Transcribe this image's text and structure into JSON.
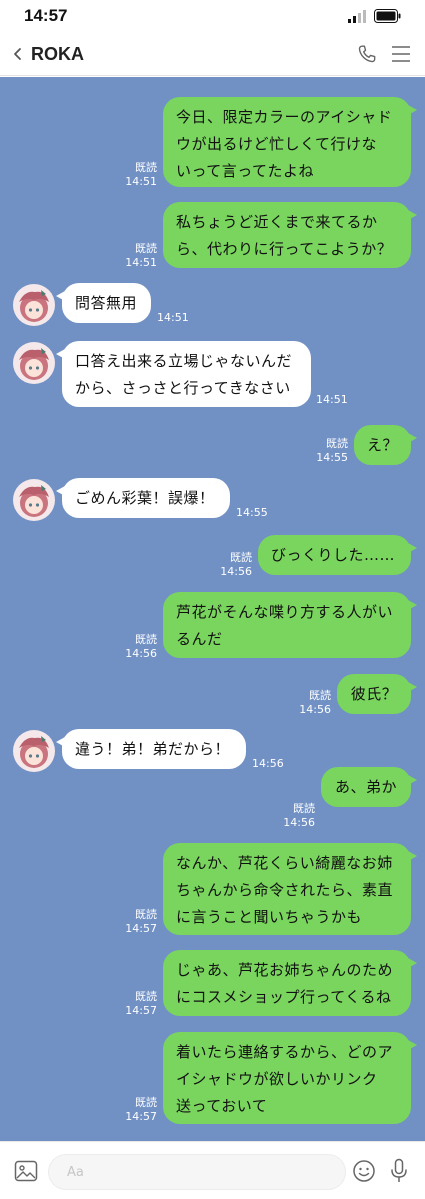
{
  "status_bar": {
    "time": "14:57"
  },
  "header": {
    "title": "ROKA"
  },
  "messages": [
    {
      "side": "out",
      "text": "今日、限定カラーのアイシャド\nウが出るけど忙しくて行けな\nいって言ってたよね",
      "read": "既読",
      "time": "14:51"
    },
    {
      "side": "out",
      "text": "私ちょうど近くまで来てるか\nら、代わりに行ってこようか？",
      "read": "既読",
      "time": "14:51"
    },
    {
      "side": "in",
      "text": "問答無用",
      "time": "14:51"
    },
    {
      "side": "in",
      "text": "口答え出来る立場じゃないんだ\nから、さっさと行ってきなさい",
      "time": "14:51"
    },
    {
      "side": "out",
      "text": "え？",
      "read": "既読",
      "time": "14:55"
    },
    {
      "side": "in",
      "text": "ごめん彩葉！誤爆！",
      "time": "14:55"
    },
    {
      "side": "out",
      "text": "びっくりした……",
      "read": "既読",
      "time": "14:56"
    },
    {
      "side": "out",
      "text": "芦花がそんな喋り方する人がい\nるんだ",
      "read": "既読",
      "time": "14:56"
    },
    {
      "side": "out",
      "text": "彼氏？",
      "read": "既読",
      "time": "14:56"
    },
    {
      "side": "in",
      "text": "違う！弟！弟だから！",
      "time": "14:56"
    },
    {
      "side": "out",
      "text": "あ、弟か",
      "read": "既読",
      "time": "14:56"
    },
    {
      "side": "out",
      "text": "なんか、芦花くらい綺麗なお姉\nちゃんから命令されたら、素直\nに言うこと聞いちゃうかも",
      "read": "既読",
      "time": "14:57"
    },
    {
      "side": "out",
      "text": "じゃあ、芦花お姉ちゃんのため\nにコスメショップ行ってくるね",
      "read": "既読",
      "time": "14:57"
    },
    {
      "side": "out",
      "text": "着いたら連絡するから、どのア\nイシャドウが欲しいかリンク\n送っておいて",
      "read": "既読",
      "time": "14:57"
    }
  ],
  "input": {
    "placeholder": "Aa",
    "value": ""
  },
  "icons": {
    "back": "chevron-left-icon",
    "call": "phone-icon",
    "menu": "menu-icon",
    "image": "image-icon",
    "emoji": "emoji-icon",
    "voice": "mic-icon"
  },
  "colors": {
    "chat_background": "#7191c5",
    "outgoing_bubble": "#79d55d",
    "incoming_bubble": "#ffffff"
  }
}
